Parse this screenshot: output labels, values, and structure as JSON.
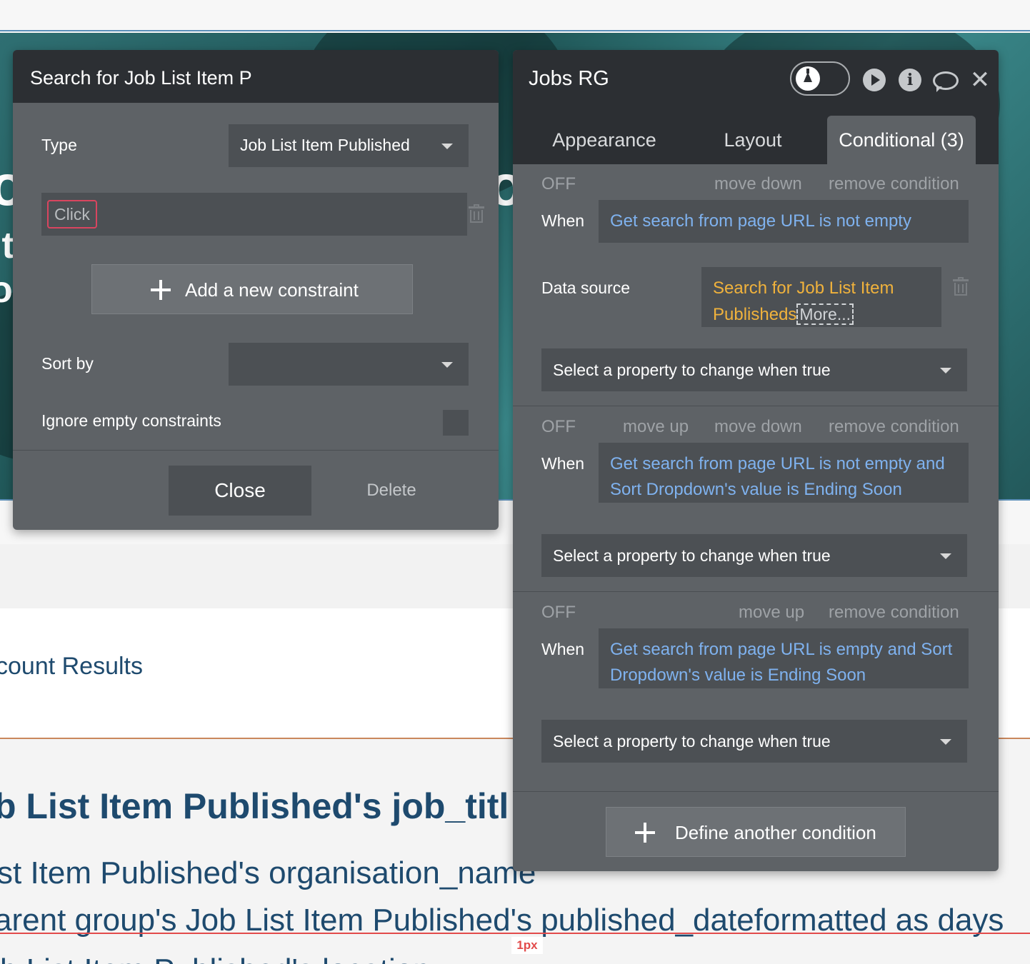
{
  "canvas": {
    "count_results": "count Results",
    "job_title": "b List Item Published's job_titl",
    "organisation": "st Item Published's organisation_name",
    "date_line": "arent group's Job List Item Published's published_dateformatted as days",
    "last_line": "b List Item Published's location",
    "measure_badge": "1px",
    "hero_fragments": [
      "o",
      "it",
      "o",
      "o"
    ]
  },
  "search_panel": {
    "title": "Search for Job List Item P",
    "type_label": "Type",
    "type_value": "Job List Item Published",
    "constraint_chip": "Click",
    "add_constraint": "Add a new constraint",
    "sort_label": "Sort by",
    "sort_value": "",
    "ignore_label": "Ignore empty constraints",
    "close": "Close",
    "delete": "Delete"
  },
  "jobs_panel": {
    "title": "Jobs RG",
    "tabs": [
      "Appearance",
      "Layout",
      "Conditional (3)"
    ],
    "active_tab": "Conditional (3)",
    "conditions": [
      {
        "status": "OFF",
        "move_up": "",
        "move_down": "move down",
        "remove": "remove condition",
        "when_label": "When",
        "when_text": "Get search from page URL is not empty",
        "data_source_label": "Data source",
        "data_source_text": "Search for Job List Item Publisheds",
        "more": "More...",
        "property_placeholder": "Select a property to change when true"
      },
      {
        "status": "OFF",
        "move_up": "move up",
        "move_down": "move down",
        "remove": "remove condition",
        "when_label": "When",
        "when_text": "Get search from page URL is not empty and Sort Dropdown's value is Ending Soon",
        "property_placeholder": "Select a property to change when true"
      },
      {
        "status": "OFF",
        "move_up": "move up",
        "move_down": "",
        "remove": "remove condition",
        "when_label": "When",
        "when_text": "Get search from page URL is empty and Sort Dropdown's value is Ending Soon",
        "property_placeholder": "Select a property to change when true"
      }
    ],
    "define_another": "Define another condition",
    "header_icons": [
      "flask-icon",
      "play-icon",
      "info-icon",
      "comment-icon",
      "close-icon"
    ]
  },
  "colors": {
    "panel_bg": "#5e6266",
    "panel_header": "#2c2f33",
    "field_bg": "#4c5054",
    "expression_blue": "#7fb2ef",
    "data_source_orange": "#f0b23c",
    "chip_border": "#d9455f",
    "canvas_text": "#1e4a6e",
    "guide_red": "#e24b4b"
  }
}
